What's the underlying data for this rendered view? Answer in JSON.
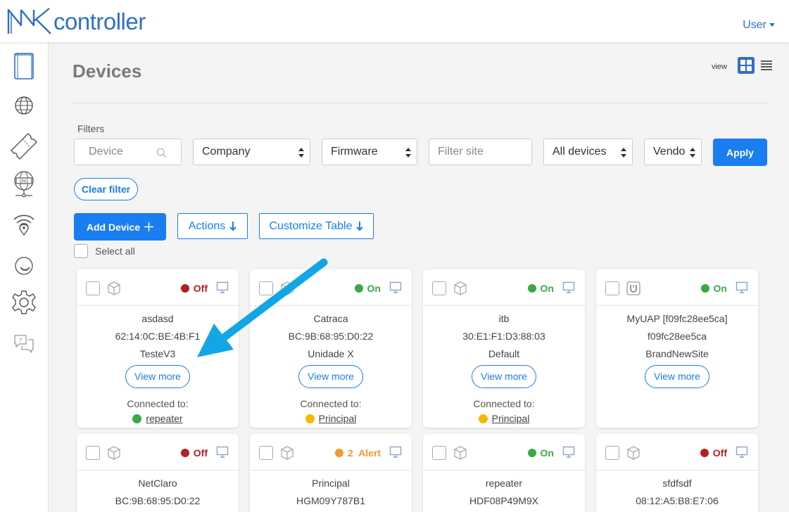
{
  "app": {
    "logo_text": "controller",
    "user_label": "User"
  },
  "sidebar": {
    "items": [
      {
        "name": "devices",
        "icon": "book-icon"
      },
      {
        "name": "sites",
        "icon": "globe-icon"
      },
      {
        "name": "vouchers",
        "icon": "ticket-icon"
      },
      {
        "name": "dns",
        "icon": "dns-icon"
      },
      {
        "name": "wifi-location",
        "icon": "wifi-location-icon"
      },
      {
        "name": "status",
        "icon": "moon-icon"
      },
      {
        "name": "settings",
        "icon": "gear-icon"
      },
      {
        "name": "support",
        "icon": "chat-help-icon"
      }
    ]
  },
  "header": {
    "title": "Devices",
    "view_label": "view"
  },
  "filters": {
    "label": "Filters",
    "device_placeholder": "Device",
    "company": "Company",
    "firmware": "Firmware",
    "site_placeholder": "Filter site",
    "devices_scope": "All devices",
    "vendor": "Vendor",
    "apply": "Apply",
    "clear": "Clear filter"
  },
  "actions": {
    "add_device": "Add Device",
    "actions": "Actions",
    "customize": "Customize Table",
    "select_all": "Select all"
  },
  "colors": {
    "accent": "#1a7df0",
    "status_on": "#3aa845",
    "status_off": "#b52020",
    "status_alert": "#f29a2e",
    "link_yellow": "#f5b800",
    "link_green": "#3aa845",
    "arrow": "#12a6e6"
  },
  "devices": [
    {
      "name": "asdasd",
      "id": "62:14:0C:BE:4B:F1",
      "site": "TesteV3",
      "status": "Off",
      "status_color": "#b52020",
      "view_more": "View more",
      "connected_label": "Connected to:",
      "connected_to": "repeater",
      "connected_color": "#3aa845",
      "type_icon": "cube-device-icon"
    },
    {
      "name": "Catraca",
      "id": "BC:9B:68:95:D0:22",
      "site": "Unidade X",
      "status": "On",
      "status_color": "#3aa845",
      "view_more": "View more",
      "connected_label": "Connected to:",
      "connected_to": "Principal",
      "connected_color": "#f5b800",
      "type_icon": "cube-device-icon"
    },
    {
      "name": "itb",
      "id": "30:E1:F1:D3:88:03",
      "site": "Default",
      "status": "On",
      "status_color": "#3aa845",
      "view_more": "View more",
      "connected_label": "Connected to:",
      "connected_to": "Principal",
      "connected_color": "#f5b800",
      "type_icon": "cube-device-icon"
    },
    {
      "name": "MyUAP [f09fc28ee5ca]",
      "id": "f09fc28ee5ca",
      "site": "BrandNewSite",
      "status": "On",
      "status_color": "#3aa845",
      "view_more": "View more",
      "type_icon": "unifi-icon"
    },
    {
      "name": "NetClaro",
      "id": "BC:9B:68:95:D0:22",
      "status": "Off",
      "status_color": "#b52020",
      "type_icon": "cube-device-icon"
    },
    {
      "name": "Principal",
      "id": "HGM09Y787B1",
      "status": "2  Alert",
      "status_color": "#f29a2e",
      "type_icon": "cube-device-icon"
    },
    {
      "name": "repeater",
      "id": "HDF08P49M9X",
      "status": "On",
      "status_color": "#3aa845",
      "type_icon": "cube-device-icon"
    },
    {
      "name": "sfdfsdf",
      "id": "08:12:A5:B8:E7:06",
      "status": "Off",
      "status_color": "#b52020",
      "type_icon": "cube-device-icon"
    }
  ]
}
